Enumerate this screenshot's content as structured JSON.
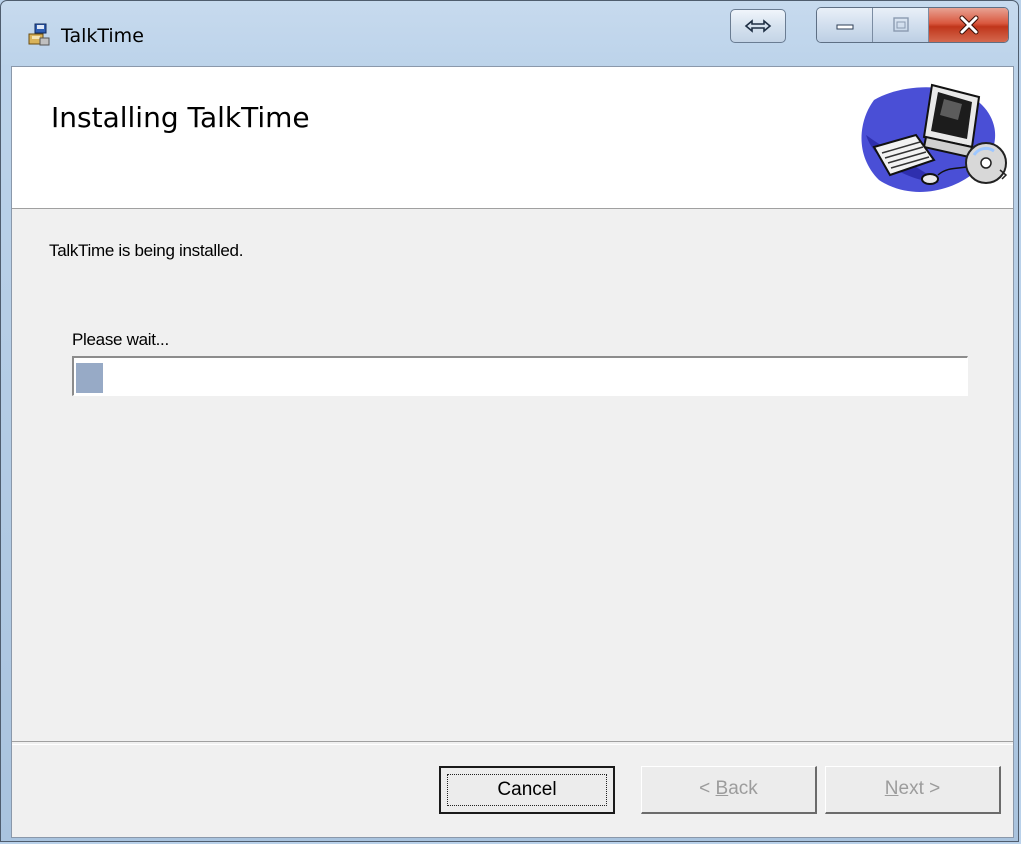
{
  "window": {
    "title": "TalkTime",
    "app_icon": "installer-icon",
    "controls": [
      "resize-icon",
      "minimize-icon",
      "maximize-icon",
      "close-icon"
    ]
  },
  "banner": {
    "heading": "Installing TalkTime",
    "graphic": "computer-setup-graphic"
  },
  "body": {
    "status_text": "TalkTime is being installed.",
    "wait_label": "Please wait...",
    "progress_fraction": 0.03,
    "progress_color": "#97aac6"
  },
  "buttons": {
    "cancel": "Cancel",
    "back_prefix": "< ",
    "back_accel": "B",
    "back_rest": "ack",
    "next_accel": "N",
    "next_rest": "ext >"
  },
  "colors": {
    "accent_close": "#c7452a",
    "frame": "#bcd3ea"
  }
}
